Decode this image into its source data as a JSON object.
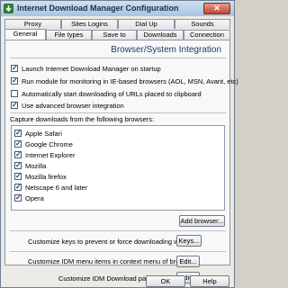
{
  "window": {
    "title": "Internet Download Manager Configuration",
    "close_label": "✕"
  },
  "tabs_row_back": [
    "Proxy",
    "Sites Logins",
    "Dial Up",
    "Sounds"
  ],
  "tabs_row_front": [
    "General",
    "File types",
    "Save to",
    "Downloads",
    "Connection"
  ],
  "section_title": "Browser/System Integration",
  "options": [
    {
      "label": "Launch Internet Download Manager on startup",
      "checked": true
    },
    {
      "label": "Run module for monitoring in IE-based browsers (AOL, MSN, Avant, etc)",
      "checked": true
    },
    {
      "label": "Automatically start downloading of URLs placed to clipboard",
      "checked": false
    },
    {
      "label": "Use advanced browser integration",
      "checked": true
    }
  ],
  "capture_label": "Capture downloads from the following browsers:",
  "browsers": [
    {
      "label": "Apple Safari",
      "checked": true
    },
    {
      "label": "Google Chrome",
      "checked": true
    },
    {
      "label": "Internet Explorer",
      "checked": true
    },
    {
      "label": "Mozilla",
      "checked": true
    },
    {
      "label": "Mozilla firefox",
      "checked": true
    },
    {
      "label": "Netscape 6 and later",
      "checked": true
    },
    {
      "label": "Opera",
      "checked": true
    }
  ],
  "add_browser_label": "Add browser...",
  "keys": {
    "text": "Customize keys to prevent or force downloading with IDM",
    "button": "Keys..."
  },
  "context_menu": {
    "text": "Customize IDM menu items in context menu of browsers",
    "button": "Edit..."
  },
  "panels": {
    "text": "Customize IDM Download panels in browsers",
    "button": "Edit..."
  },
  "footer": {
    "ok": "OK",
    "help": "Help"
  }
}
